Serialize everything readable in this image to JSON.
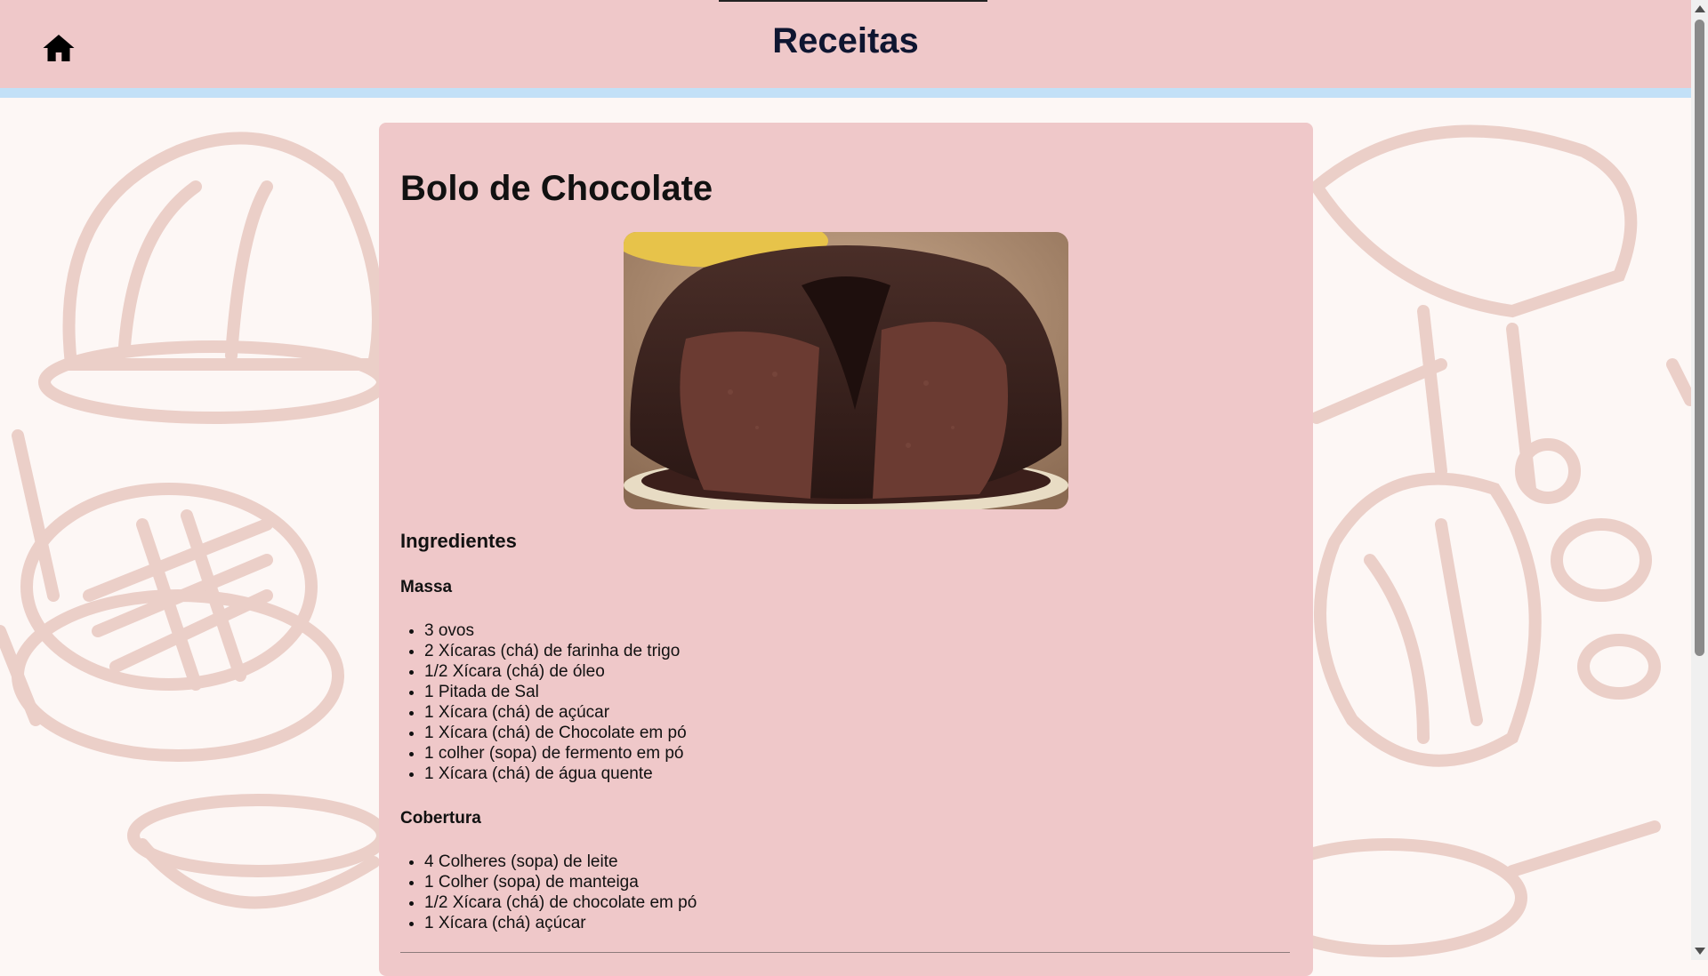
{
  "header": {
    "title": "Receitas",
    "home_icon": "home-icon",
    "background_color": "#efc8c9",
    "accent_line_color": "#c2e0f7"
  },
  "recipe": {
    "title": "Bolo de Chocolate",
    "image_alt": "chocolate-bundt-cake",
    "ingredients_heading": "Ingredientes",
    "sections": [
      {
        "heading": "Massa",
        "items": [
          "3 ovos",
          "2 Xícaras (chá) de farinha de trigo",
          "1/2 Xícara (chá) de óleo",
          "1 Pitada de Sal",
          "1 Xícara (chá) de açúcar",
          "1 Xícara (chá) de Chocolate em pó",
          "1 colher (sopa) de fermento em pó",
          "1 Xícara (chá) de água quente"
        ]
      },
      {
        "heading": "Cobertura",
        "items": [
          "4 Colheres (sopa) de leite",
          "1 Colher (sopa) de manteiga",
          "1/2 Xícara (chá) de chocolate em pó",
          "1 Xícara (chá) açúcar"
        ]
      }
    ]
  }
}
